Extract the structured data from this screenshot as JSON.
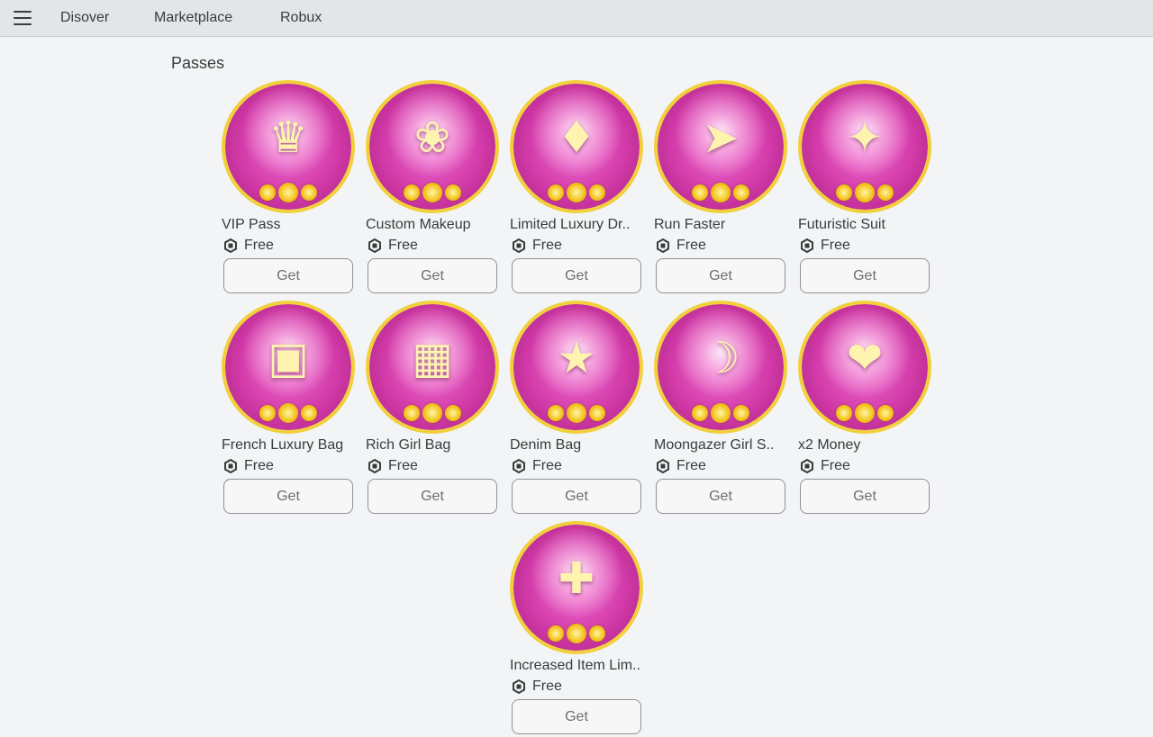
{
  "nav": {
    "menu_icon": "hamburger-menu-icon",
    "links": [
      "Disover",
      "Marketplace",
      "Robux"
    ]
  },
  "section": {
    "title": "Passes"
  },
  "currency_icon": "robux-icon",
  "colors": {
    "background": "#f2f4f5",
    "topbar": "#e3e5e7",
    "thumb_border": "#f2d03b",
    "thumb_pink": "#d23aa8"
  },
  "passes": [
    {
      "name": "VIP Pass",
      "price": "Free",
      "button": "Get",
      "icon": "crown-vip-icon"
    },
    {
      "name": "Custom Makeup",
      "price": "Free",
      "button": "Get",
      "icon": "makeup-icon"
    },
    {
      "name": "Limited Luxury Dr..",
      "price": "Free",
      "button": "Get",
      "icon": "dress-icon"
    },
    {
      "name": "Run Faster",
      "price": "Free",
      "button": "Get",
      "icon": "heel-shoe-icon"
    },
    {
      "name": "Futuristic Suit",
      "price": "Free",
      "button": "Get",
      "icon": "suit-icon"
    },
    {
      "name": "French Luxury Bag",
      "price": "Free",
      "button": "Get",
      "icon": "handbag-icon"
    },
    {
      "name": "Rich Girl Bag",
      "price": "Free",
      "button": "Get",
      "icon": "quilted-bag-icon"
    },
    {
      "name": "Denim Bag",
      "price": "Free",
      "button": "Get",
      "icon": "denim-bag-icon"
    },
    {
      "name": "Moongazer Girl S..",
      "price": "Free",
      "button": "Get",
      "icon": "outfit-icon"
    },
    {
      "name": "x2 Money",
      "price": "Free",
      "button": "Get",
      "icon": "money-icon"
    },
    {
      "name": "Increased Item Lim..",
      "price": "Free",
      "button": "Get",
      "icon": "hat-shirt-icon"
    }
  ]
}
